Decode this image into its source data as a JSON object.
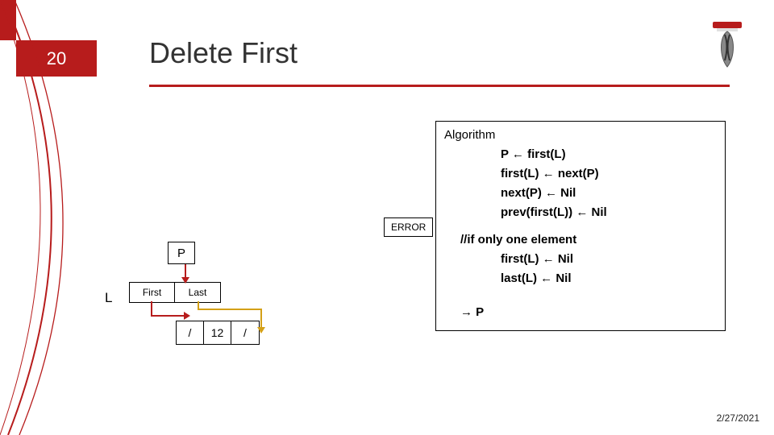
{
  "slide": {
    "number": "20",
    "title": "Delete First",
    "date": "2/27/2021"
  },
  "algorithm": {
    "heading": "Algorithm",
    "lines": [
      "P ← first(L)",
      "first(L) ← next(P)",
      "next(P) ← Nil",
      "prev(first(L)) ← Nil"
    ],
    "comment": "//if only one element",
    "comment_lines": [
      "first(L) ← Nil",
      "last(L) ← Nil"
    ],
    "return": "→ P"
  },
  "error_label": "ERROR",
  "diagram": {
    "P": "P",
    "L": "L",
    "first": "First",
    "last": "Last",
    "node_prev": "/",
    "node_val": "12",
    "node_next": "/"
  },
  "colors": {
    "accent": "#b71c1c"
  },
  "chart_data": {
    "type": "table",
    "title": "Algorithm: Delete First (doubly linked list)",
    "steps": [
      "P ← first(L)",
      "first(L) ← next(P)",
      "next(P) ← Nil",
      "prev(first(L)) ← Nil  (ERROR case noted)"
    ],
    "special_case": "if only one element: first(L) ← Nil; last(L) ← Nil",
    "returns": "P",
    "diagram_state": {
      "L.First": "→ node",
      "L.Last": "→ node",
      "node": [
        "/",
        12,
        "/"
      ],
      "P": "→ node"
    }
  }
}
